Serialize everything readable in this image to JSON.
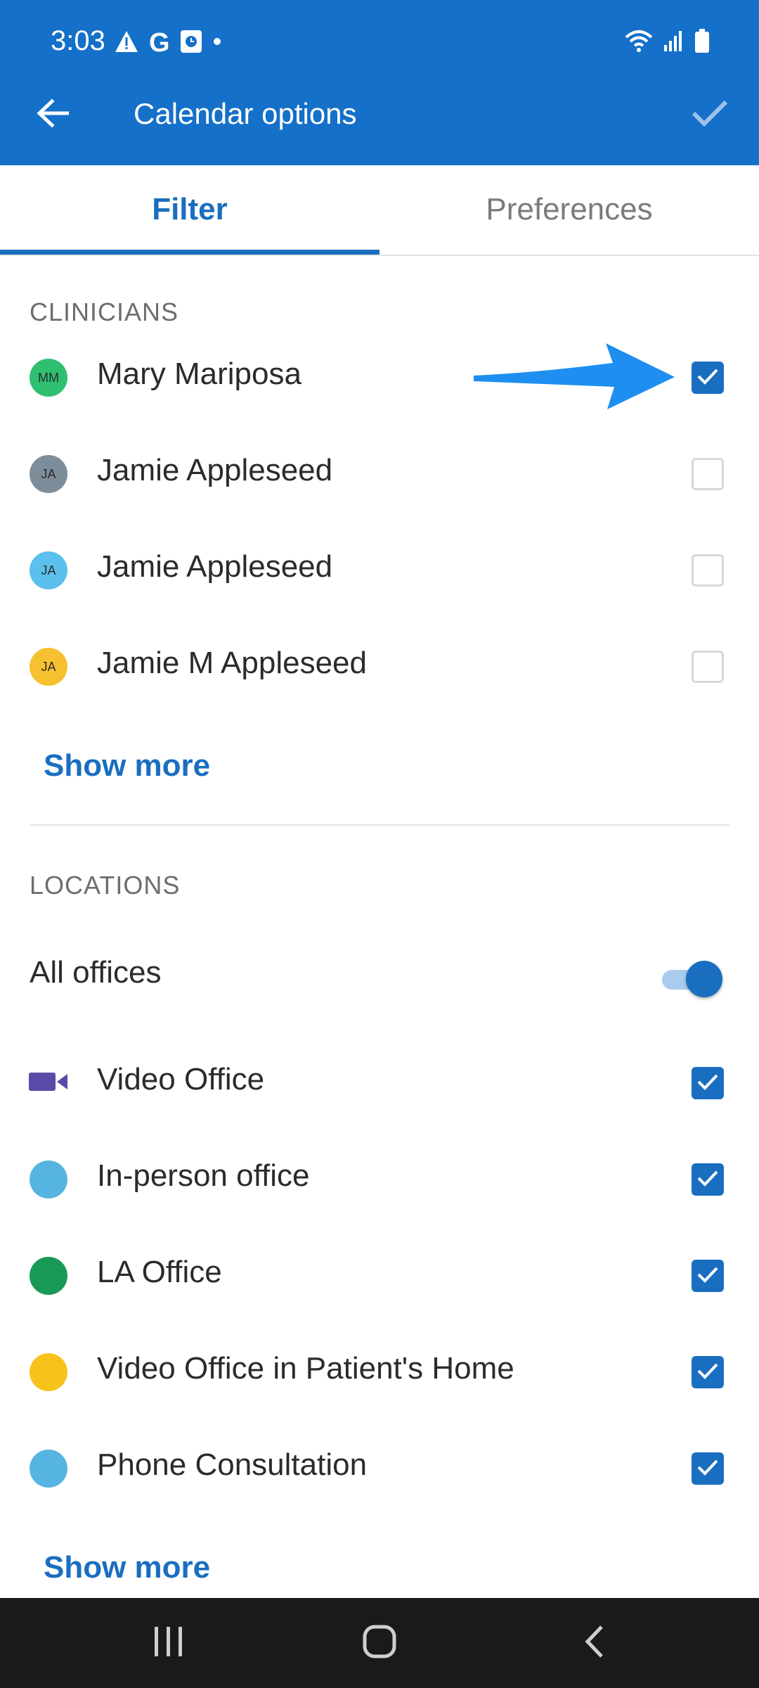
{
  "status_bar": {
    "time": "3:03",
    "left_icons": [
      "warning-icon",
      "google-icon",
      "clock-app-icon",
      "dot-icon"
    ],
    "right_icons": [
      "wifi-icon",
      "signal-icon",
      "battery-icon"
    ]
  },
  "toolbar": {
    "title": "Calendar options",
    "back_icon": "arrow-left-icon",
    "confirm_icon": "check-icon"
  },
  "tabs": [
    {
      "label": "Filter",
      "selected": true
    },
    {
      "label": "Preferences",
      "selected": false
    }
  ],
  "clinicians": {
    "title": "CLINICIANS",
    "items": [
      {
        "initials": "MM",
        "name": "Mary Mariposa",
        "color": "#2fbf71",
        "checked": true
      },
      {
        "initials": "JA",
        "name": "Jamie Appleseed",
        "color": "#7e8d9a",
        "checked": false
      },
      {
        "initials": "JA",
        "name": "Jamie Appleseed",
        "color": "#5bc0ec",
        "checked": false
      },
      {
        "initials": "JA",
        "name": "Jamie M Appleseed",
        "color": "#f6c12e",
        "checked": false
      }
    ],
    "show_more": "Show more"
  },
  "locations": {
    "title": "LOCATIONS",
    "all_offices": {
      "label": "All offices",
      "enabled": true
    },
    "items": [
      {
        "name": "Video Office",
        "icon": "video-camera-icon",
        "color": "#5b4aa8",
        "checked": true
      },
      {
        "name": "In-person office",
        "icon": "dot",
        "color": "#56b4e0",
        "checked": true
      },
      {
        "name": "LA Office",
        "icon": "dot",
        "color": "#189a55",
        "checked": true
      },
      {
        "name": "Video Office in Patient's Home",
        "icon": "dot",
        "color": "#f8c21d",
        "checked": true
      },
      {
        "name": "Phone Consultation",
        "icon": "dot",
        "color": "#56b4e0",
        "checked": true
      }
    ],
    "show_more": "Show more"
  },
  "annotation": {
    "icon": "blue-arrow-icon",
    "color": "#1e8ff0"
  },
  "nav_bar": [
    "recents-icon",
    "home-icon",
    "back-icon"
  ],
  "colors": {
    "primary": "#1470c8",
    "accent": "#1a6ec0"
  }
}
